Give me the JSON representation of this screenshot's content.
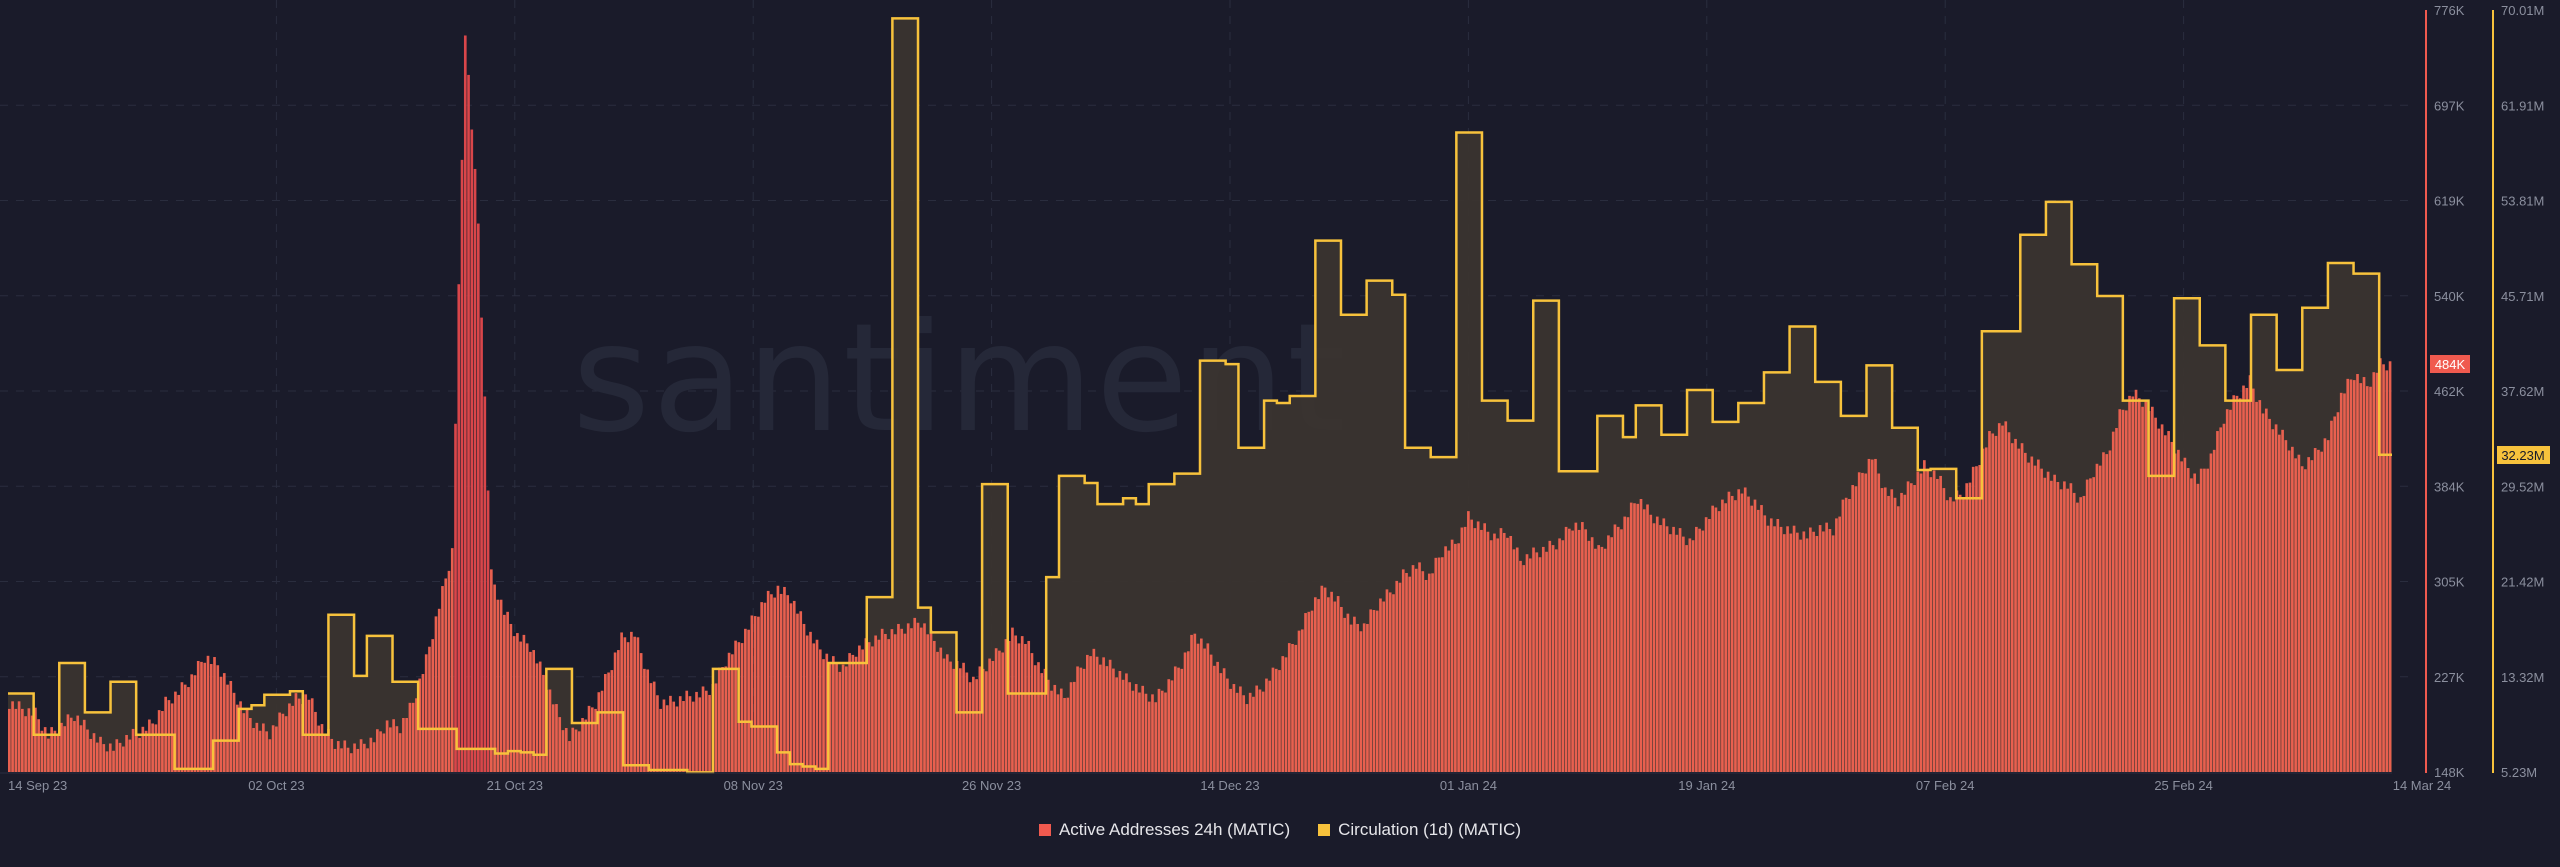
{
  "chart_data": {
    "type": "line",
    "title": "",
    "watermark": "santiment",
    "x_range": [
      "2023-09-14",
      "2024-03-14"
    ],
    "x_ticks": [
      "14 Sep 23",
      "02 Oct 23",
      "21 Oct 23",
      "08 Nov 23",
      "26 Nov 23",
      "14 Dec 23",
      "01 Jan 24",
      "19 Jan 24",
      "07 Feb 24",
      "25 Feb 24",
      "14 Mar 24"
    ],
    "left_axis": {
      "series": "Active Addresses 24h (MATIC)",
      "ticks": [
        "776K",
        "697K",
        "619K",
        "540K",
        "462K",
        "384K",
        "305K",
        "227K",
        "148K"
      ],
      "ylim": [
        148000,
        776000
      ],
      "current_value_label": "484K"
    },
    "right_axis": {
      "series": "Circulation (1d) (MATIC)",
      "ticks": [
        "70.01M",
        "61.91M",
        "53.81M",
        "45.71M",
        "37.62M",
        "29.52M",
        "21.42M",
        "13.32M",
        "5.23M"
      ],
      "ylim": [
        5230000,
        70010000
      ],
      "current_value_label": "32.23M"
    },
    "series": [
      {
        "name": "Active Addresses 24h (MATIC)",
        "type": "bar",
        "color": "#f05a4f",
        "unit": "K",
        "values": [
          205,
          200,
          196,
          178,
          186,
          195,
          183,
          172,
          168,
          176,
          181,
          188,
          205,
          214,
          226,
          243,
          236,
          218,
          199,
          186,
          180,
          196,
          208,
          210,
          185,
          172,
          168,
          170,
          175,
          188,
          185,
          205,
          240,
          285,
          330,
          760,
          600,
          310,
          280,
          260,
          252,
          228,
          199,
          176,
          190,
          205,
          230,
          258,
          262,
          230,
          205,
          206,
          210,
          212,
          218,
          240,
          255,
          272,
          290,
          299,
          292,
          270,
          252,
          240,
          234,
          248,
          255,
          261,
          264,
          268,
          272,
          256,
          240,
          236,
          224,
          236,
          248,
          262,
          256,
          236,
          220,
          209,
          230,
          246,
          240,
          231,
          222,
          214,
          208,
          222,
          238,
          262,
          249,
          232,
          218,
          209,
          216,
          229,
          245,
          262,
          286,
          300,
          288,
          272,
          268,
          286,
          296,
          310,
          318,
          309,
          330,
          336,
          358,
          350,
          342,
          346,
          322,
          328,
          332,
          338,
          352,
          348,
          330,
          344,
          356,
          374,
          360,
          352,
          346,
          338,
          352,
          366,
          374,
          380,
          370,
          356,
          350,
          346,
          343,
          349,
          348,
          374,
          390,
          408,
          380,
          372,
          386,
          400,
          392,
          372,
          378,
          400,
          424,
          436,
          420,
          408,
          398,
          388,
          384,
          372,
          396,
          410,
          442,
          460,
          452,
          436,
          420,
          402,
          388,
          408,
          440,
          458,
          470,
          446,
          432,
          418,
          400,
          410,
          424,
          458,
          476,
          466,
          484
        ]
      },
      {
        "name": "Circulation (1d) (MATIC)",
        "type": "step-line",
        "color": "#f7c23c",
        "unit": "M",
        "values": [
          11.9,
          11.9,
          8.4,
          8.4,
          14.5,
          14.5,
          10.3,
          10.3,
          12.9,
          12.9,
          8.4,
          8.4,
          8.4,
          5.5,
          5.5,
          5.5,
          7.9,
          7.9,
          10.6,
          10.9,
          11.8,
          11.8,
          12.1,
          8.4,
          8.4,
          18.6,
          18.6,
          13.4,
          16.8,
          16.8,
          12.9,
          12.9,
          8.9,
          8.9,
          8.9,
          7.2,
          7.2,
          7.2,
          6.8,
          7.0,
          6.9,
          6.7,
          14.0,
          14.0,
          9.4,
          9.4,
          10.3,
          10.3,
          5.8,
          5.8,
          5.4,
          5.4,
          5.4,
          5.2,
          5.2,
          14.0,
          14.0,
          9.5,
          9.1,
          9.1,
          6.9,
          5.9,
          5.7,
          5.5,
          14.5,
          14.5,
          14.5,
          20.1,
          20.1,
          69.3,
          69.3,
          19.2,
          17.1,
          17.1,
          10.3,
          10.3,
          29.7,
          29.7,
          11.9,
          11.9,
          11.9,
          21.8,
          30.4,
          30.4,
          29.8,
          28.0,
          28.0,
          28.5,
          28.0,
          29.7,
          29.7,
          30.6,
          30.6,
          40.2,
          40.2,
          39.9,
          32.8,
          32.8,
          36.8,
          36.6,
          37.2,
          37.2,
          50.4,
          50.4,
          44.1,
          44.1,
          47.0,
          47.0,
          45.8,
          32.8,
          32.8,
          32.0,
          32.0,
          59.6,
          59.6,
          36.8,
          36.8,
          35.1,
          35.1,
          45.3,
          45.3,
          30.8,
          30.8,
          30.8,
          35.5,
          35.5,
          33.7,
          36.4,
          36.4,
          33.9,
          33.9,
          37.7,
          37.7,
          35.0,
          35.0,
          36.6,
          36.6,
          39.2,
          39.2,
          43.1,
          43.1,
          38.4,
          38.4,
          35.5,
          35.5,
          39.8,
          39.8,
          34.5,
          34.5,
          30.9,
          31.0,
          31.0,
          28.5,
          28.5,
          42.7,
          42.7,
          42.7,
          50.9,
          50.9,
          53.7,
          53.7,
          48.4,
          48.4,
          45.7,
          45.7,
          36.8,
          36.8,
          30.4,
          30.4,
          45.5,
          45.5,
          41.5,
          41.5,
          36.8,
          36.8,
          44.1,
          44.1,
          39.4,
          39.4,
          44.7,
          44.7,
          48.5,
          48.5,
          47.6,
          47.6,
          32.2
        ]
      }
    ]
  },
  "legend": [
    {
      "label": "Active Addresses 24h (MATIC)",
      "color": "#f05a4f"
    },
    {
      "label": "Circulation (1d) (MATIC)",
      "color": "#f7c23c"
    }
  ]
}
